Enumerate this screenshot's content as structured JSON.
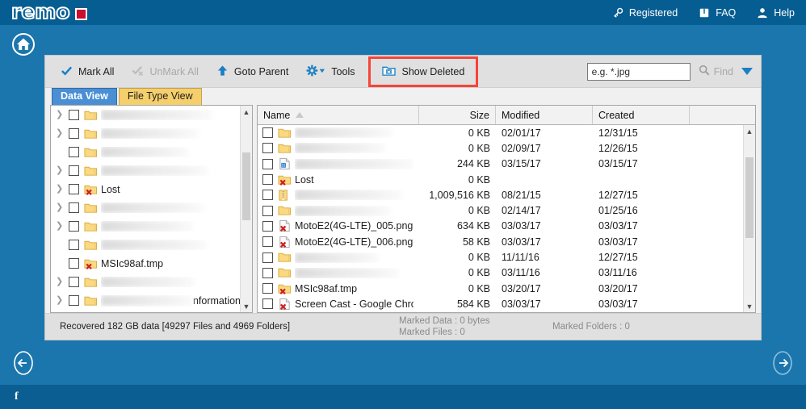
{
  "app": {
    "logo_text": "remo",
    "colors": {
      "header_blue": "#065d92",
      "body_blue": "#1b76ad",
      "accent_red": "#c8102e",
      "highlight_red": "#f6443a",
      "tab_active_blue": "#4a8fd4",
      "tab_inactive_yellow": "#f5cf6c"
    }
  },
  "header": {
    "links": [
      {
        "label": "Registered",
        "icon": "key-icon"
      },
      {
        "label": "FAQ",
        "icon": "book-icon"
      },
      {
        "label": "Help",
        "icon": "person-icon"
      }
    ]
  },
  "home_button": {
    "icon": "home-icon"
  },
  "toolbar": {
    "items": [
      {
        "label": "Mark All",
        "icon": "checkmark-icon",
        "state": "enabled"
      },
      {
        "label": "UnMark All",
        "icon": "uncheck-icon",
        "state": "disabled"
      },
      {
        "label": "Goto Parent",
        "icon": "up-arrow-icon",
        "state": "enabled"
      },
      {
        "label": "Tools",
        "icon": "gear-dropdown-icon",
        "state": "enabled"
      },
      {
        "label": "Show Deleted",
        "icon": "deleted-folder-icon",
        "state": "highlighted"
      }
    ],
    "search": {
      "placeholder": "e.g. *.jpg",
      "value": "",
      "find_label": "Find",
      "find_state": "disabled",
      "dropdown_icon": "caret-down-icon"
    }
  },
  "tabs": [
    {
      "label": "Data View",
      "active": true
    },
    {
      "label": "File Type View",
      "active": false
    }
  ],
  "tree": {
    "rows": [
      {
        "name": "",
        "blurred": true,
        "blur_width": 138,
        "twisty": true,
        "icon": "folder-icon"
      },
      {
        "name": "",
        "blurred": true,
        "blur_width": 120,
        "twisty": true,
        "icon": "folder-icon"
      },
      {
        "name": "",
        "blurred": true,
        "blur_width": 108,
        "twisty": false,
        "icon": "folder-icon"
      },
      {
        "name": "",
        "blurred": true,
        "blur_width": 132,
        "twisty": true,
        "icon": "folder-icon"
      },
      {
        "name": "Lost",
        "blurred": false,
        "blur_width": 0,
        "twisty": true,
        "icon": "deleted-folder-icon"
      },
      {
        "name": "",
        "blurred": true,
        "blur_width": 126,
        "twisty": true,
        "icon": "folder-icon"
      },
      {
        "name": "",
        "blurred": true,
        "blur_width": 114,
        "twisty": true,
        "icon": "folder-icon"
      },
      {
        "name": "",
        "blurred": true,
        "blur_width": 130,
        "twisty": false,
        "icon": "folder-icon"
      },
      {
        "name": "MSIc98af.tmp",
        "blurred": false,
        "blur_width": 0,
        "twisty": false,
        "icon": "deleted-folder-icon"
      },
      {
        "name": "",
        "blurred": true,
        "blur_width": 116,
        "twisty": true,
        "icon": "folder-icon"
      },
      {
        "name": "nformation",
        "blurred": true,
        "blur_width": 120,
        "twisty": true,
        "icon": "folder-icon"
      },
      {
        "name": "",
        "blurred": true,
        "blur_width": 112,
        "twisty": false,
        "icon": "folder-icon"
      },
      {
        "name": "",
        "blurred": true,
        "blur_width": 128,
        "twisty": true,
        "icon": "folder-icon"
      }
    ],
    "scrollbar": {
      "up_icon": "chevron-up-icon",
      "down_icon": "chevron-down-icon"
    }
  },
  "filelist": {
    "columns": [
      {
        "key": "name",
        "label": "Name",
        "sort": "ascending"
      },
      {
        "key": "size",
        "label": "Size",
        "sort": "none"
      },
      {
        "key": "modified",
        "label": "Modified",
        "sort": "none"
      },
      {
        "key": "created",
        "label": "Created",
        "sort": "none"
      }
    ],
    "rows": [
      {
        "name": "",
        "blurred": true,
        "blur_width": 120,
        "icon": "folder-icon",
        "size": "0 KB",
        "modified": "02/01/17",
        "created": "12/31/15"
      },
      {
        "name": "",
        "blurred": true,
        "blur_width": 112,
        "icon": "folder-icon",
        "size": "0 KB",
        "modified": "02/09/17",
        "created": "12/26/15"
      },
      {
        "name": "",
        "blurred": true,
        "blur_width": 150,
        "icon": "document-icon",
        "size": "244 KB",
        "modified": "03/15/17",
        "created": "03/15/17"
      },
      {
        "name": "Lost",
        "blurred": false,
        "blur_width": 0,
        "icon": "deleted-folder-icon",
        "size": "0 KB",
        "modified": "",
        "created": ""
      },
      {
        "name": "",
        "blurred": true,
        "blur_width": 132,
        "icon": "archive-icon",
        "size": "1,009,516 KB",
        "modified": "08/21/15",
        "created": "12/27/15"
      },
      {
        "name": "",
        "blurred": true,
        "blur_width": 118,
        "icon": "folder-icon",
        "size": "0 KB",
        "modified": "02/14/17",
        "created": "01/25/16"
      },
      {
        "name": "MotoE2(4G-LTE)_005.png",
        "blurred": false,
        "blur_width": 0,
        "icon": "deleted-file-icon",
        "size": "634 KB",
        "modified": "03/03/17",
        "created": "03/03/17"
      },
      {
        "name": "MotoE2(4G-LTE)_006.png",
        "blurred": false,
        "blur_width": 0,
        "icon": "deleted-file-icon",
        "size": "58 KB",
        "modified": "03/03/17",
        "created": "03/03/17"
      },
      {
        "name": "",
        "blurred": true,
        "blur_width": 104,
        "icon": "folder-icon",
        "size": "0 KB",
        "modified": "11/11/16",
        "created": "12/27/15"
      },
      {
        "name": "",
        "blurred": true,
        "blur_width": 128,
        "icon": "folder-icon",
        "size": "0 KB",
        "modified": "03/11/16",
        "created": "03/11/16"
      },
      {
        "name": "MSIc98af.tmp",
        "blurred": false,
        "blur_width": 0,
        "icon": "deleted-folder-icon",
        "size": "0 KB",
        "modified": "03/20/17",
        "created": "03/20/17"
      },
      {
        "name": "Screen Cast - Google Chro...",
        "blurred": false,
        "blur_width": 0,
        "icon": "deleted-file-icon",
        "size": "584 KB",
        "modified": "03/03/17",
        "created": "03/03/17"
      }
    ],
    "scrollbar": {
      "up_icon": "chevron-up-icon",
      "down_icon": "chevron-down-icon"
    }
  },
  "statusbar": {
    "recovered": "Recovered 182 GB data [49297 Files and 4969 Folders]",
    "marked_data": "Marked Data : 0 bytes",
    "marked_files": "Marked Files : 0",
    "marked_folders": "Marked Folders : 0"
  },
  "navigation": {
    "back_icon": "arrow-left-circle-icon",
    "next_icon": "arrow-right-circle-icon"
  },
  "bottombar": {
    "facebook": "f"
  }
}
